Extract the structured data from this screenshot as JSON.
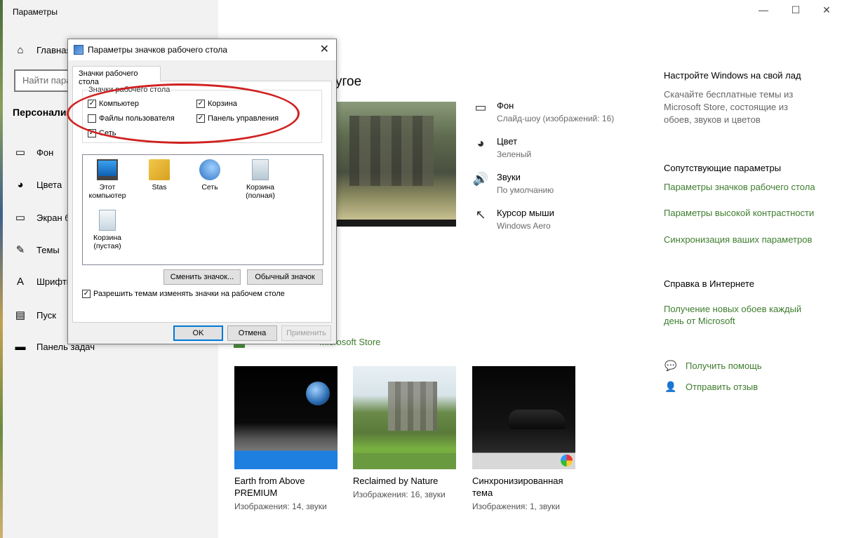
{
  "window": {
    "title": "Параметры",
    "minimize": "—",
    "maximize": "☐",
    "close": "✕"
  },
  "sidebar": {
    "home": "Главная",
    "search_placeholder": "Найти пара",
    "section": "Персонализ",
    "items": [
      {
        "label": "Фон",
        "icon": "picture-icon",
        "glyph": "▭"
      },
      {
        "label": "Цвета",
        "icon": "palette-icon",
        "glyph": "◕"
      },
      {
        "label": "Экран б",
        "icon": "lock-screen-icon",
        "glyph": "▭"
      },
      {
        "label": "Темы",
        "icon": "brush-icon",
        "glyph": "✎"
      },
      {
        "label": "Шрифты",
        "icon": "font-icon",
        "glyph": "A"
      },
      {
        "label": "Пуск",
        "icon": "start-icon",
        "glyph": "▤"
      },
      {
        "label": "Панель задач",
        "icon": "taskbar-icon",
        "glyph": "▬"
      }
    ]
  },
  "main": {
    "heading": "угое",
    "theme_props": [
      {
        "title": "Фон",
        "value": "Слайд-шоу (изображений: 16)",
        "icon": "picture-icon",
        "glyph": "▭"
      },
      {
        "title": "Цвет",
        "value": "Зеленый",
        "icon": "palette-icon",
        "glyph": "◕"
      },
      {
        "title": "Звуки",
        "value": "По умолчанию",
        "icon": "speaker-icon",
        "glyph": "🔊"
      },
      {
        "title": "Курсор мыши",
        "value": "Windows Aero",
        "icon": "cursor-icon",
        "glyph": "↖"
      }
    ],
    "store_link": "Microsoft Store",
    "themes": [
      {
        "name": "Earth from Above PREMIUM",
        "meta": "Изображения: 14, звуки"
      },
      {
        "name": "Reclaimed by Nature",
        "meta": "Изображения: 16, звуки"
      },
      {
        "name": "Синхронизированная тема",
        "meta": "Изображения: 1, звуки"
      }
    ]
  },
  "right": {
    "h1": "Настройте Windows на свой лад",
    "p1": "Скачайте бесплатные темы из Microsoft Store, состоящие из обоев, звуков и цветов",
    "h2": "Сопутствующие параметры",
    "link1": "Параметры значков рабочего стола",
    "link2": "Параметры высокой контрастности",
    "link3": "Синхронизация ваших параметров",
    "h3": "Справка в Интернете",
    "link4": "Получение новых обоев каждый день от Microsoft",
    "help": "Получить помощь",
    "feedback": "Отправить отзыв"
  },
  "dialog": {
    "title": "Параметры значков рабочего стола",
    "close": "✕",
    "tab": "Значки рабочего стола",
    "group": "Значки рабочего стола",
    "checks": {
      "computer": "Компьютер",
      "recycle": "Корзина",
      "user_files": "Файлы пользователя",
      "control_panel": "Панель управления",
      "network": "Сеть"
    },
    "icons": [
      {
        "label": "Этот компьютер"
      },
      {
        "label": "Stas"
      },
      {
        "label": "Сеть"
      },
      {
        "label": "Корзина (полная)"
      },
      {
        "label": "Корзина (пустая)"
      }
    ],
    "change_icon": "Сменить значок...",
    "default_icon": "Обычный значок",
    "allow_themes": "Разрешить темам изменять значки на рабочем столе",
    "ok": "OK",
    "cancel": "Отмена",
    "apply": "Применить",
    "checkmark": "✓"
  },
  "colors": {
    "accent_green": "#3e7d2d",
    "annotation_red": "#d02020"
  }
}
